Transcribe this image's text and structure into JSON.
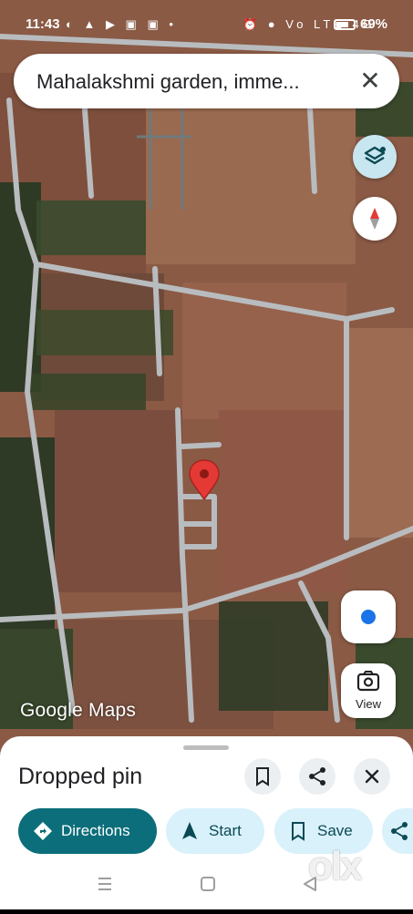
{
  "status_bar": {
    "time": "11:43",
    "left_icons": "◐ ▲ ▶ ▣ ▣ •",
    "right_icons": "⏰ ● Vo LTE 4G",
    "battery": "69%"
  },
  "search": {
    "text": "Mahalakshmi garden, imme...",
    "close_icon": "✕"
  },
  "map": {
    "branding": "Google Maps",
    "view_label": "View",
    "watermark": "olx"
  },
  "sheet": {
    "title": "Dropped pin",
    "actions": {
      "directions": "Directions",
      "start": "Start",
      "save": "Save"
    }
  },
  "colors": {
    "accent_primary": "#0b6e7a",
    "chip_bg": "#d9f1fb",
    "pin_red": "#e53935"
  }
}
